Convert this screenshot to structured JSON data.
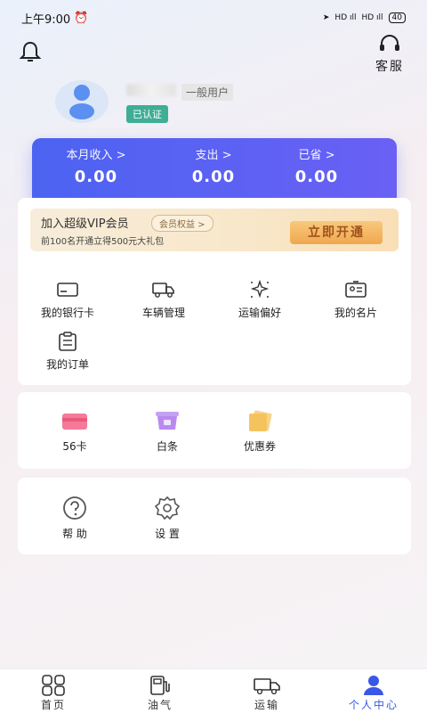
{
  "status_bar": {
    "time": "上午9:00",
    "battery": "40"
  },
  "header": {
    "service_label": "客服"
  },
  "profile": {
    "user_type": "一般用户",
    "verified_badge": "已认证"
  },
  "stats": [
    {
      "label": "本月收入 >",
      "value": "0.00"
    },
    {
      "label": "支出 >",
      "value": "0.00"
    },
    {
      "label": "已省 >",
      "value": "0.00"
    }
  ],
  "vip": {
    "title": "加入超级VIP会员",
    "tag": "会员权益 >",
    "subtitle": "前100名开通立得500元大礼包",
    "button": "立即开通"
  },
  "main_grid": [
    {
      "label": "我的银行卡",
      "icon": "bank-card-icon"
    },
    {
      "label": "车辆管理",
      "icon": "truck-icon"
    },
    {
      "label": "运输偏好",
      "icon": "sparkle-icon"
    },
    {
      "label": "我的名片",
      "icon": "id-card-icon"
    },
    {
      "label": "我的订单",
      "icon": "clipboard-icon"
    }
  ],
  "wallet_grid": [
    {
      "label": "56卡",
      "icon": "card-56-icon"
    },
    {
      "label": "白条",
      "icon": "iou-icon"
    },
    {
      "label": "优惠券",
      "icon": "coupon-icon"
    }
  ],
  "misc_grid": [
    {
      "label": "帮 助",
      "icon": "help-icon"
    },
    {
      "label": "设 置",
      "icon": "settings-icon"
    }
  ],
  "tabs": [
    {
      "label": "首页",
      "icon": "home-grid-icon"
    },
    {
      "label": "油气",
      "icon": "fuel-icon"
    },
    {
      "label": "运输",
      "icon": "transport-truck-icon"
    },
    {
      "label": "个人中心",
      "icon": "person-icon",
      "active": true
    }
  ],
  "colors": {
    "accent": "#4c63f2",
    "verified": "#3fae95",
    "vip_button": "#f0a74e",
    "active_tab": "#3a57e8"
  }
}
